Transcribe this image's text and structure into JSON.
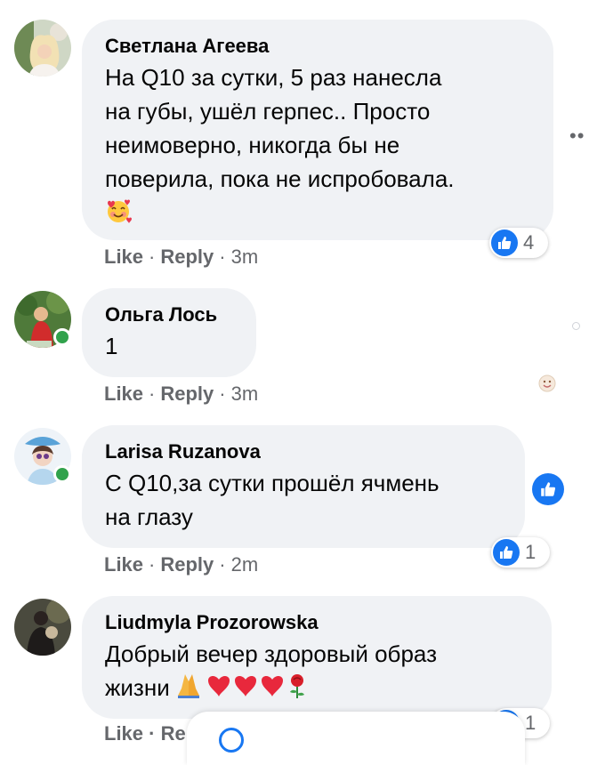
{
  "actions": {
    "like": "Like",
    "reply": "Reply",
    "separator": "·"
  },
  "colors": {
    "accent": "#1877f2",
    "bubble": "#f0f2f5",
    "muted": "#65676b",
    "online": "#31a24c"
  },
  "comments": [
    {
      "author": "Светлана Агеева",
      "lines": [
        "На Q10 за сутки, 5 раз нанесла",
        "на губы, ушёл герпес.. Просто",
        "неимоверно, никогда бы не",
        "поверила, пока не испробовала."
      ],
      "emoji": "smiling-face-with-hearts-icon",
      "time": "3m",
      "reactions": "4",
      "online": false
    },
    {
      "author": "Ольга Лось",
      "lines": [
        "1"
      ],
      "time": "3m",
      "online": true
    },
    {
      "author": "Larisa Ruzanova",
      "lines": [
        "С Q10,за сутки прошёл ячмень",
        "на глазу"
      ],
      "time": "2m",
      "reactions": "1",
      "online": true
    },
    {
      "author": "Liudmyla Prozorowska",
      "lines": [
        "Добрый вечер здоровый образ",
        "жизни"
      ],
      "emoji": "folded-hands-hearts-rose-icons",
      "time": "",
      "reactions": "1",
      "online": false
    }
  ],
  "partial_action_text": "Like · Re"
}
